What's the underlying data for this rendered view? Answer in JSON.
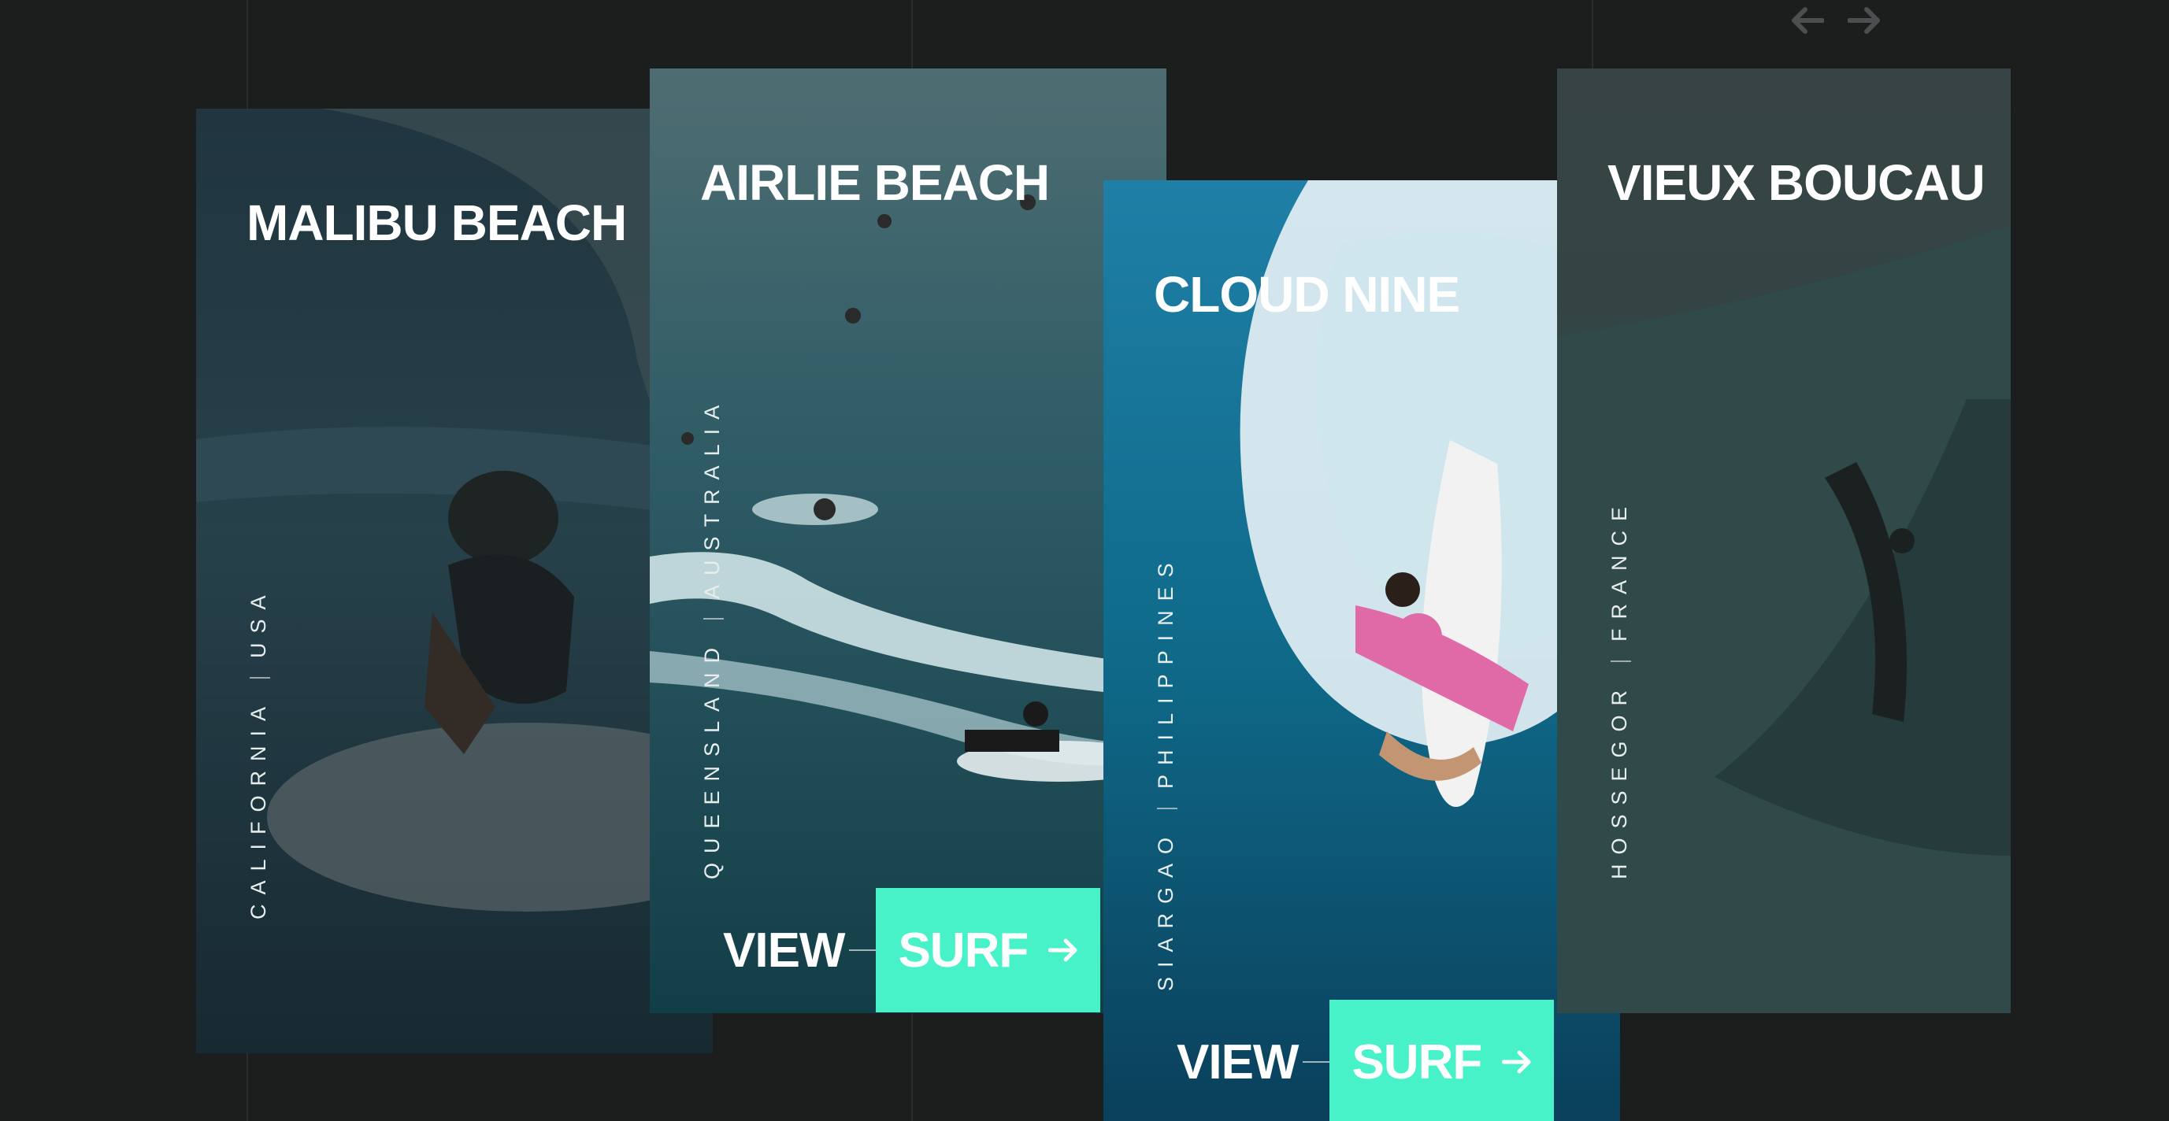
{
  "nav": {
    "prev_icon": "arrow-left-icon",
    "next_icon": "arrow-right-icon"
  },
  "colors": {
    "background": "#1c1e1e",
    "accent": "#48f2c9",
    "text": "#ffffff"
  },
  "cards": [
    {
      "title": "MALIBU BEACH",
      "region": "CALIFORNIA",
      "country": "USA"
    },
    {
      "title": "AIRLIE BEACH",
      "region": "QUEENSLAND",
      "country": "AUSTRALIA",
      "cta_view": "VIEW",
      "cta_surf": "SURF"
    },
    {
      "title": "CLOUD NINE",
      "region": "SIARGAO",
      "country": "PHILIPPINES",
      "cta_view": "VIEW",
      "cta_surf": "SURF"
    },
    {
      "title": "VIEUX BOUCAU",
      "region": "HOSSEGOR",
      "country": "FRANCE"
    }
  ]
}
